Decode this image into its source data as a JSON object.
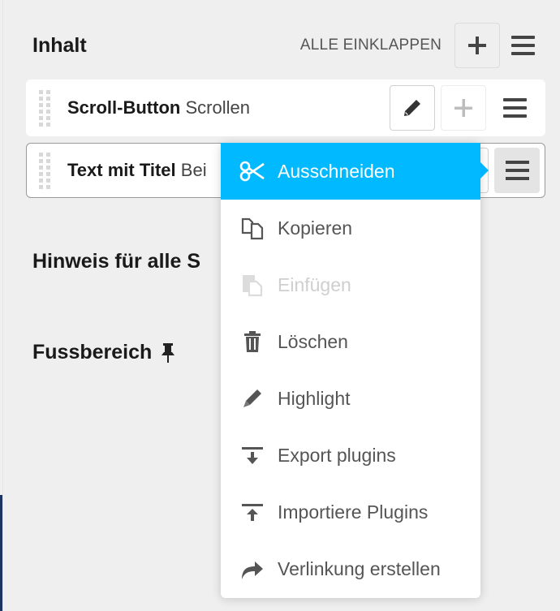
{
  "section": {
    "title": "Inhalt",
    "collapse_all_label": "ALLE EINKLAPPEN",
    "add_icon": "plus-icon",
    "menu_icon": "hamburger-icon"
  },
  "plugins": [
    {
      "name": "Scroll-Button",
      "description": "Scrollen",
      "actions": [
        "edit",
        "add",
        "menu"
      ]
    },
    {
      "name": "Text mit Titel",
      "description": "Bei",
      "actions": [
        "edit",
        "add",
        "menu"
      ]
    }
  ],
  "placeholders": [
    {
      "title": "Hinweis für alle S",
      "pinned": false
    },
    {
      "title": "Fussbereich",
      "pinned": true,
      "pin_icon": "pushpin-icon"
    }
  ],
  "context_menu": {
    "items": [
      {
        "label": "Ausschneiden",
        "icon": "scissors-icon",
        "state": "active"
      },
      {
        "label": "Kopieren",
        "icon": "copy-icon",
        "state": "normal"
      },
      {
        "label": "Einfügen",
        "icon": "paste-icon",
        "state": "disabled"
      },
      {
        "label": "Löschen",
        "icon": "trash-icon",
        "state": "normal"
      },
      {
        "label": "Highlight",
        "icon": "pencil-icon",
        "state": "normal"
      },
      {
        "label": "Export plugins",
        "icon": "export-icon",
        "state": "normal"
      },
      {
        "label": "Importiere Plugins",
        "icon": "import-icon",
        "state": "normal"
      },
      {
        "label": "Verlinkung erstellen",
        "icon": "share-arrow-icon",
        "state": "normal"
      }
    ]
  },
  "colors": {
    "accent": "#00b9ff",
    "background": "#efefef",
    "sidebar_strip": "#1d3461"
  }
}
